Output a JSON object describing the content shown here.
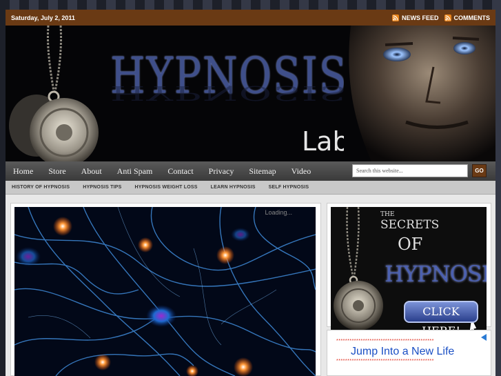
{
  "topbar": {
    "date": "Saturday, July 2, 2011",
    "news_feed": "NEWS FEED",
    "comments": "COMMENTS",
    "icon": "rss-icon"
  },
  "header": {
    "logo_main": "HYPNOSIS",
    "logo_sub": "Lab"
  },
  "nav": {
    "items": [
      {
        "label": "Home"
      },
      {
        "label": "Store"
      },
      {
        "label": "About"
      },
      {
        "label": "Anti Spam"
      },
      {
        "label": "Contact"
      },
      {
        "label": "Privacy"
      },
      {
        "label": "Sitemap"
      },
      {
        "label": "Video"
      }
    ],
    "search_placeholder": "Search this website...",
    "go_label": "GO"
  },
  "subnav": {
    "items": [
      {
        "label": "HISTORY OF HYPNOSIS"
      },
      {
        "label": "HYPNOSIS TIPS"
      },
      {
        "label": "HYPNOSIS WEIGHT LOSS"
      },
      {
        "label": "LEARN HYPNOSIS"
      },
      {
        "label": "SELF HYPNOSIS"
      }
    ]
  },
  "slideshow": {
    "loading": "Loading..."
  },
  "ad": {
    "the": "THE",
    "secrets": "SECRETS",
    "of": "OF",
    "hypnosis": "HYPNOSIS",
    "cta": "CLICK HERE!"
  },
  "ad2": {
    "stars": "********************************************",
    "title": "Jump Into a New Life"
  },
  "colors": {
    "topbar": "#6a3a14",
    "nav": "#4a4a4a",
    "accent_blue": "#3f4f8a"
  }
}
